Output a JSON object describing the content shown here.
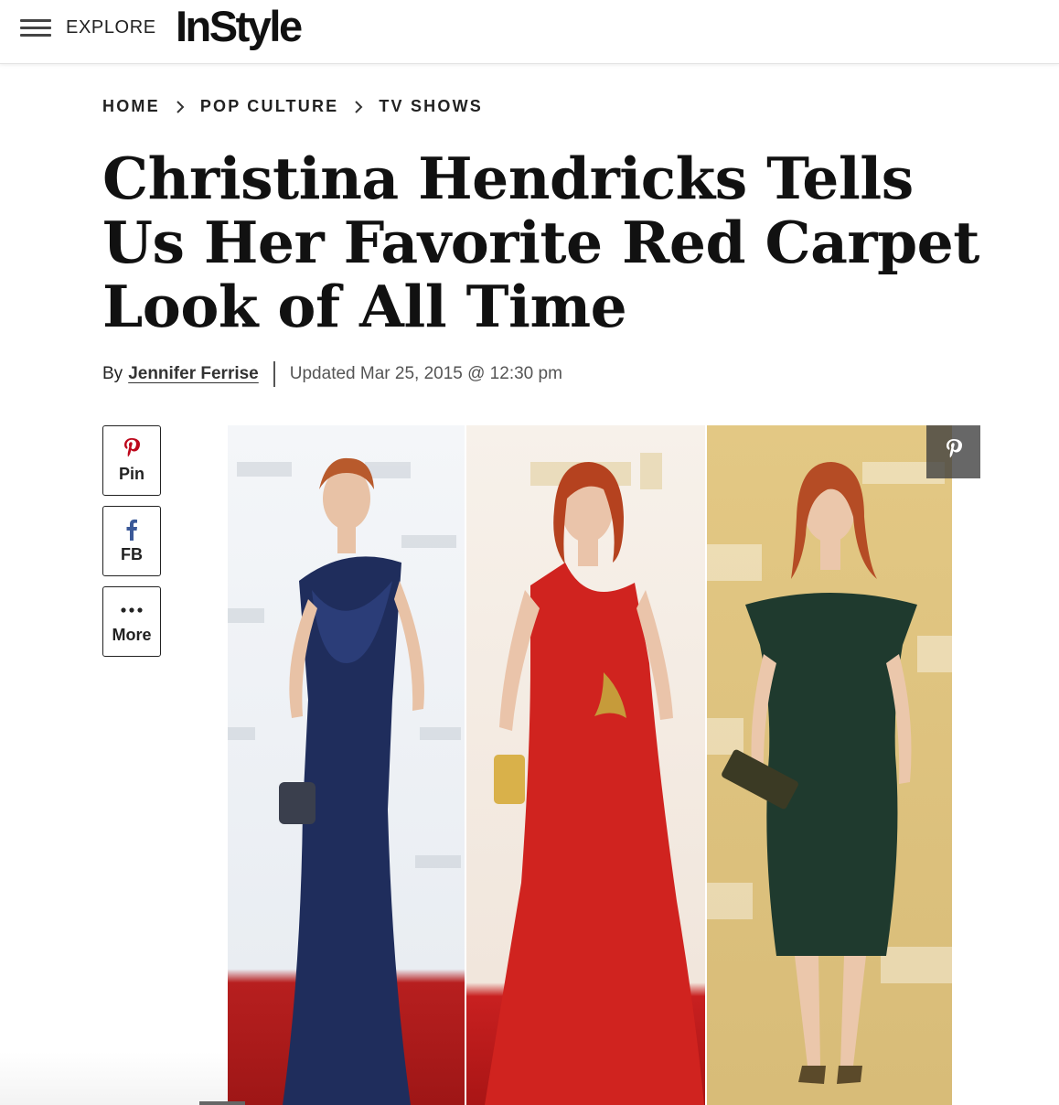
{
  "header": {
    "explore_label": "EXPLORE",
    "logo_text": "InStyle"
  },
  "breadcrumb": [
    "HOME",
    "POP CULTURE",
    "TV SHOWS"
  ],
  "article": {
    "title": "Christina Hendricks Tells Us Her Favorite Red Carpet Look of All Time",
    "byline_prefix": "By",
    "author": "Jennifer Ferrise",
    "updated": "Updated Mar 25, 2015 @ 12:30 pm"
  },
  "share": {
    "pin_label": "Pin",
    "fb_label": "FB",
    "more_label": "More"
  },
  "hero": {
    "panels": [
      {
        "dress_color": "#1f2d5c",
        "backdrop": "#eef1f5"
      },
      {
        "dress_color": "#d0231f",
        "backdrop": "#f4ebe2"
      },
      {
        "dress_color": "#1f3a2e",
        "backdrop": "#dcc27e"
      }
    ]
  },
  "colors": {
    "pinterest_red": "#bd081c",
    "facebook_blue": "#3b5998",
    "text": "#111111"
  },
  "icons": [
    "menu-icon",
    "chevron-right-icon",
    "pinterest-icon",
    "facebook-icon",
    "ellipsis-icon"
  ]
}
